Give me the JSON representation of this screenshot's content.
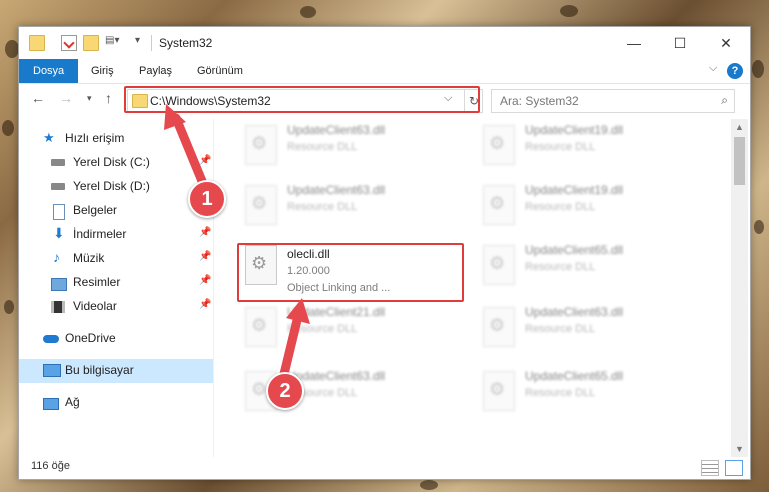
{
  "window": {
    "title": "System32",
    "controls": {
      "minimize": "—",
      "maximize": "☐",
      "close": "✕"
    }
  },
  "ribbon": {
    "tabs": [
      "Dosya",
      "Giriş",
      "Paylaş",
      "Görünüm"
    ],
    "help": "?"
  },
  "address": {
    "path": "C:\\Windows\\System32",
    "search_placeholder": "Ara: System32"
  },
  "sidebar": {
    "items": [
      {
        "label": "Hızlı erişim",
        "icon": "star-icon",
        "pinned": false
      },
      {
        "label": "Yerel Disk (C:)",
        "icon": "drive-icon",
        "pinned": true
      },
      {
        "label": "Yerel Disk (D:)",
        "icon": "drive-icon",
        "pinned": false
      },
      {
        "label": "Belgeler",
        "icon": "documents-icon",
        "pinned": true
      },
      {
        "label": "İndirmeler",
        "icon": "download-icon",
        "pinned": true
      },
      {
        "label": "Müzik",
        "icon": "music-icon",
        "pinned": true
      },
      {
        "label": "Resimler",
        "icon": "pictures-icon",
        "pinned": true
      },
      {
        "label": "Videolar",
        "icon": "videos-icon",
        "pinned": true
      },
      {
        "label": "OneDrive",
        "icon": "cloud-icon",
        "pinned": false
      },
      {
        "label": "Bu bilgisayar",
        "icon": "computer-icon",
        "pinned": false
      },
      {
        "label": "Ağ",
        "icon": "network-icon",
        "pinned": false
      }
    ]
  },
  "files": [
    {
      "name": "UpdateClient63.dll",
      "type": "Resource DLL"
    },
    {
      "name": "UpdateClient19.dll",
      "type": "Resource DLL"
    },
    {
      "name": "UpdateClient63.dll",
      "type": "Resource DLL"
    },
    {
      "name": "UpdateClient19.dll",
      "type": "Resource DLL"
    },
    {
      "name": "olecli.dll",
      "version": "1.20.000",
      "description": "Object Linking and ..."
    },
    {
      "name": "UpdateClient65.dll",
      "type": "Resource DLL"
    },
    {
      "name": "UpdateClient21.dll",
      "type": "Resource DLL"
    },
    {
      "name": "UpdateClient63.dll",
      "type": "Resource DLL"
    },
    {
      "name": "UpdateClient63.dll",
      "type": "Resource DLL"
    },
    {
      "name": "UpdateClient65.dll",
      "type": "Resource DLL"
    }
  ],
  "status": {
    "item_count": "116 öğe"
  },
  "annotations": {
    "step1": "1",
    "step2": "2",
    "highlight_color": "#e03c3c"
  }
}
